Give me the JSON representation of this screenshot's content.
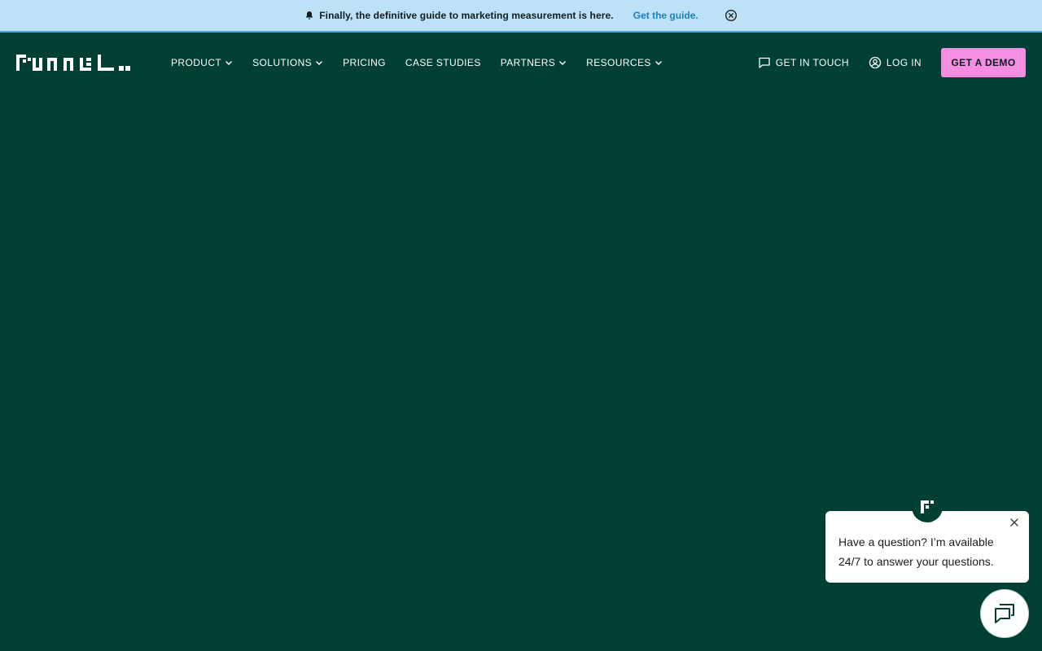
{
  "announcement": {
    "message": "Finally, the definitive guide to marketing measurement is here.",
    "cta": "Get the guide."
  },
  "nav": {
    "logo_alt": "funnel",
    "items": [
      {
        "label": "PRODUCT",
        "dropdown": true
      },
      {
        "label": "SOLUTIONS",
        "dropdown": true
      },
      {
        "label": "PRICING",
        "dropdown": false
      },
      {
        "label": "CASE STUDIES",
        "dropdown": false
      },
      {
        "label": "PARTNERS",
        "dropdown": true
      },
      {
        "label": "RESOURCES",
        "dropdown": true
      }
    ],
    "get_in_touch": "GET IN TOUCH",
    "log_in": "LOG IN",
    "get_demo": "GET A DEMO"
  },
  "chat": {
    "message": "Have a question? I’m available 24/7 to answer your questions."
  },
  "colors": {
    "background": "#003f33",
    "announcement_bg": "#bde2f8",
    "accent_pink": "#f38ee3",
    "link_blue": "#1d7fb6"
  },
  "icons": [
    "bell-icon",
    "close-circle-icon",
    "chevron-down-icon",
    "chat-bubble-icon",
    "user-circle-icon",
    "close-icon",
    "funnel-avatar-icon",
    "chat-launcher-icon"
  ]
}
